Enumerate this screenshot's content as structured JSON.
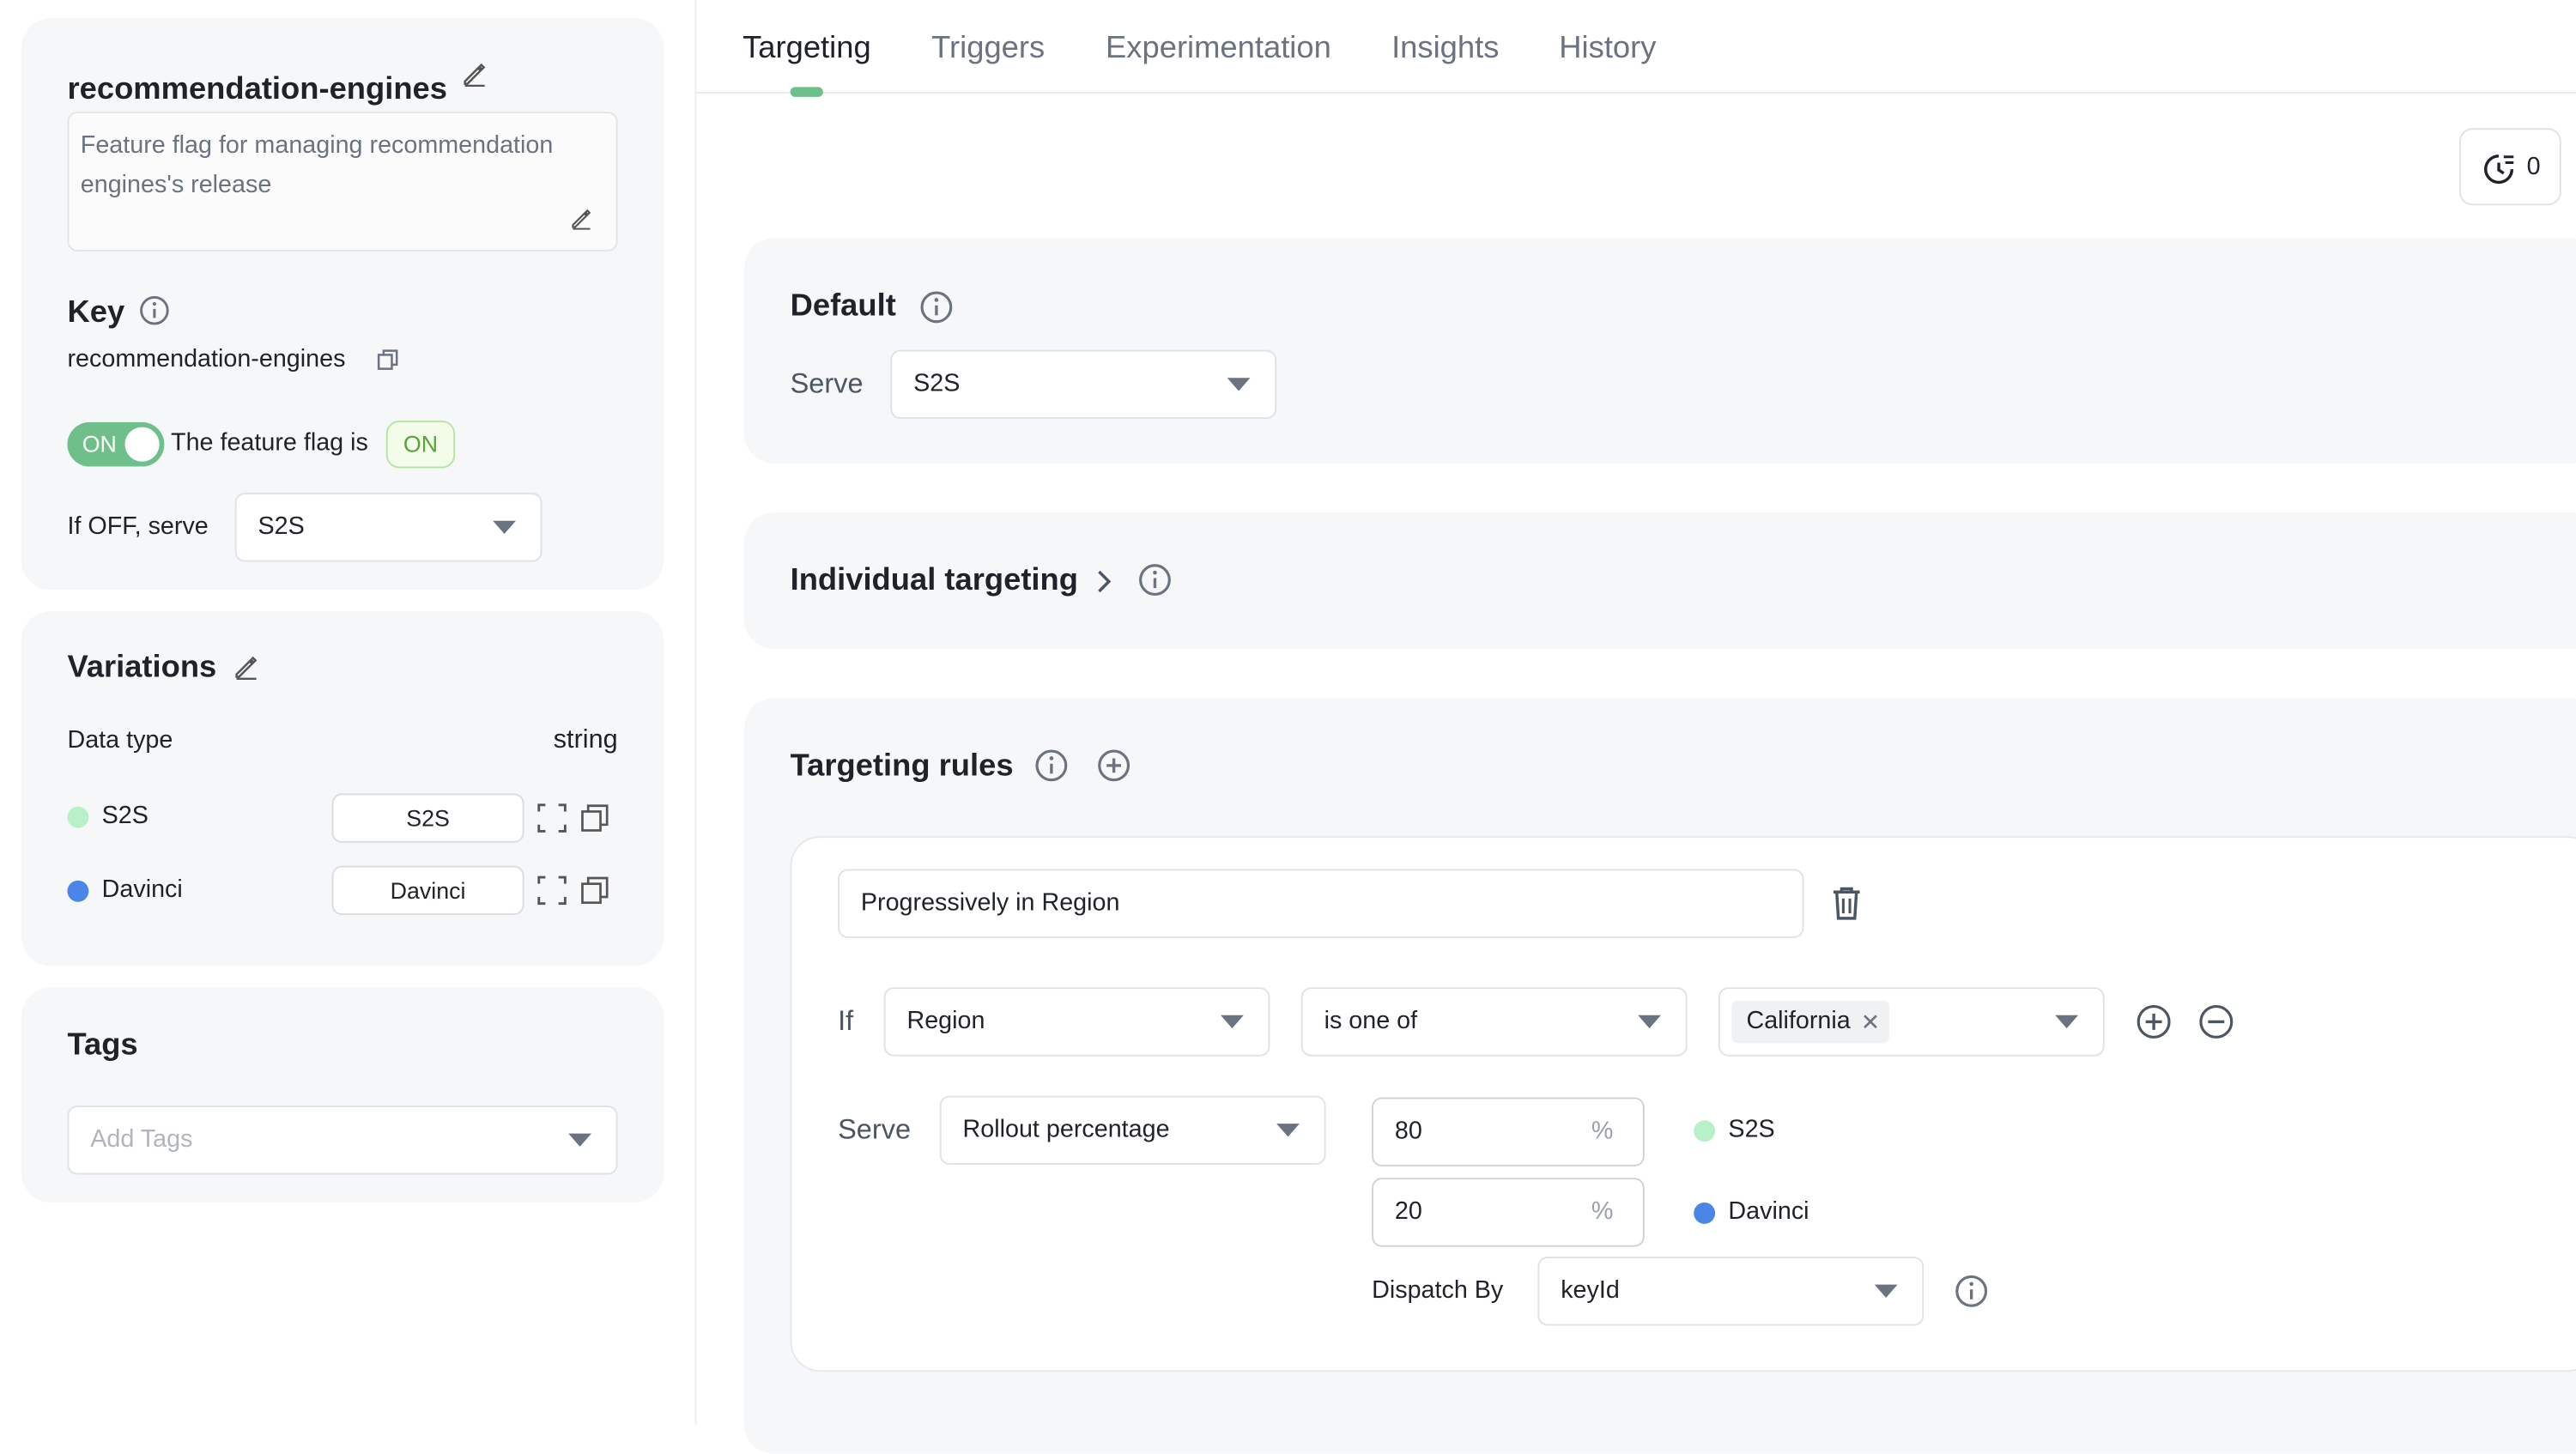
{
  "sidebar": {
    "flag_name": "recommendation-engines",
    "description": "Feature flag for managing recommendation engines's release",
    "key_title": "Key",
    "key_value": "recommendation-engines",
    "toggle_label": "ON",
    "status_text": "The feature flag is",
    "status_badge": "ON",
    "if_off_label": "If OFF, serve",
    "if_off_value": "S2S",
    "variations_title": "Variations",
    "data_type_label": "Data type",
    "data_type_value": "string",
    "variations": [
      {
        "name": "S2S",
        "value": "S2S",
        "color": "#b8f0c8"
      },
      {
        "name": "Davinci",
        "value": "Davinci",
        "color": "#4a86e8"
      }
    ],
    "tags_title": "Tags",
    "tags_placeholder": "Add Tags"
  },
  "tabs": [
    {
      "label": "Targeting",
      "active": true
    },
    {
      "label": "Triggers",
      "active": false
    },
    {
      "label": "Experimentation",
      "active": false
    },
    {
      "label": "Insights",
      "active": false
    },
    {
      "label": "History",
      "active": false
    }
  ],
  "history_button": {
    "count": "0"
  },
  "default_panel": {
    "title": "Default",
    "serve_label": "Serve",
    "serve_value": "S2S"
  },
  "individual_targeting": {
    "title": "Individual targeting"
  },
  "targeting_rules": {
    "title": "Targeting rules",
    "rule": {
      "name": "Progressively in Region",
      "if_label": "If",
      "attribute": "Region",
      "operator": "is one of",
      "values": [
        "California"
      ],
      "serve_label": "Serve",
      "serve_mode": "Rollout percentage",
      "rollout": [
        {
          "percent": "80",
          "unit": "%",
          "variation": "S2S",
          "color": "#b8f0c8"
        },
        {
          "percent": "20",
          "unit": "%",
          "variation": "Davinci",
          "color": "#4a86e8"
        }
      ],
      "dispatch_label": "Dispatch By",
      "dispatch_value": "keyId"
    }
  },
  "colors": {
    "accent": "#6fbf8a",
    "panel_bg": "#f6f7f9"
  }
}
